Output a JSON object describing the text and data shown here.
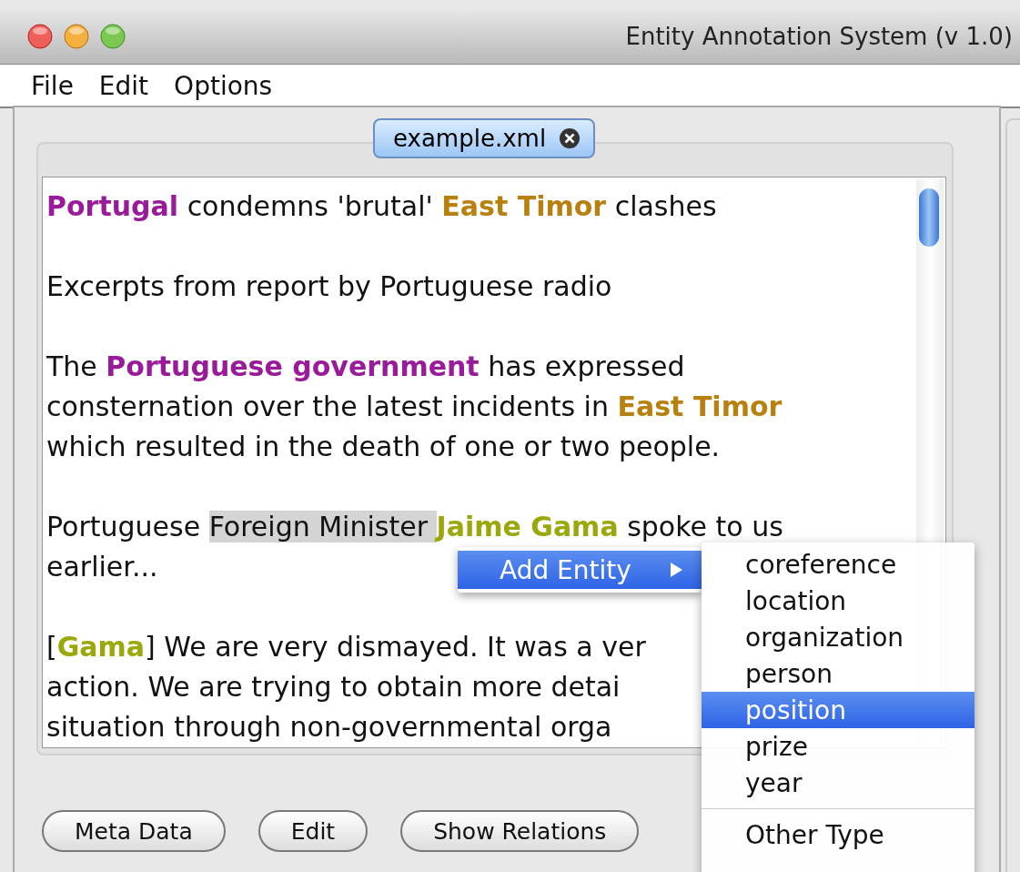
{
  "window": {
    "title": "Entity Annotation System (v 1.0)"
  },
  "menu_bar": [
    "File",
    "Edit",
    "Options"
  ],
  "tabs": [
    {
      "label": "example.xml",
      "selected": true
    }
  ],
  "document": {
    "paragraphs": [
      [
        [
          {
            "kind": "entity",
            "text": "Portugal",
            "color": "#9a1b9a"
          },
          {
            "kind": "plain",
            "text": " condemns 'brutal' "
          },
          {
            "kind": "entity",
            "text": "East Timor",
            "color": "#b8800f"
          },
          {
            "kind": "plain",
            "text": " clashes"
          }
        ]
      ],
      [
        [
          {
            "kind": "plain",
            "text": "Excerpts from report by Portuguese radio"
          }
        ]
      ],
      [
        [
          {
            "kind": "plain",
            "text": "The "
          },
          {
            "kind": "entity",
            "text": "Portuguese government",
            "color": "#9a1b9a"
          },
          {
            "kind": "plain",
            "text": " has expressed"
          }
        ],
        [
          {
            "kind": "plain",
            "text": "consternation over the latest incidents in "
          },
          {
            "kind": "entity",
            "text": "East Timor",
            "color": "#b8800f"
          }
        ],
        [
          {
            "kind": "plain",
            "text": "which resulted in the death of one or two people."
          }
        ]
      ],
      [
        [
          {
            "kind": "plain",
            "text": "Portuguese "
          },
          {
            "kind": "selected",
            "text": "Foreign Minister "
          },
          {
            "kind": "entity",
            "text": "Jaime Gama",
            "color": "#9aa80c"
          },
          {
            "kind": "plain",
            "text": " spoke to us"
          }
        ],
        [
          {
            "kind": "plain",
            "text": "earlier..."
          }
        ]
      ],
      [
        [
          {
            "kind": "plain",
            "text": "["
          },
          {
            "kind": "entity",
            "text": "Gama",
            "color": "#9aa80c"
          },
          {
            "kind": "plain",
            "text": "] We are very dismayed. It was a ver"
          }
        ],
        [
          {
            "kind": "plain",
            "text": "action. We are trying to obtain more detai"
          }
        ],
        [
          {
            "kind": "plain",
            "text": "situation through non-governmental orga"
          }
        ]
      ]
    ]
  },
  "buttons": [
    "Meta Data",
    "Edit",
    "Show Relations"
  ],
  "context_menu": {
    "items": [
      {
        "label": "Add Entity",
        "selected": true
      }
    ],
    "submenu": [
      {
        "kind": "item",
        "label": "coreference",
        "selected": false
      },
      {
        "kind": "item",
        "label": "location",
        "selected": false
      },
      {
        "kind": "item",
        "label": "organization",
        "selected": false
      },
      {
        "kind": "item",
        "label": "person",
        "selected": false
      },
      {
        "kind": "item",
        "label": "position",
        "selected": true
      },
      {
        "kind": "item",
        "label": "prize",
        "selected": false
      },
      {
        "kind": "item",
        "label": "year",
        "selected": false
      },
      {
        "kind": "separator"
      },
      {
        "kind": "item",
        "label": "Other Type",
        "selected": false
      }
    ]
  }
}
